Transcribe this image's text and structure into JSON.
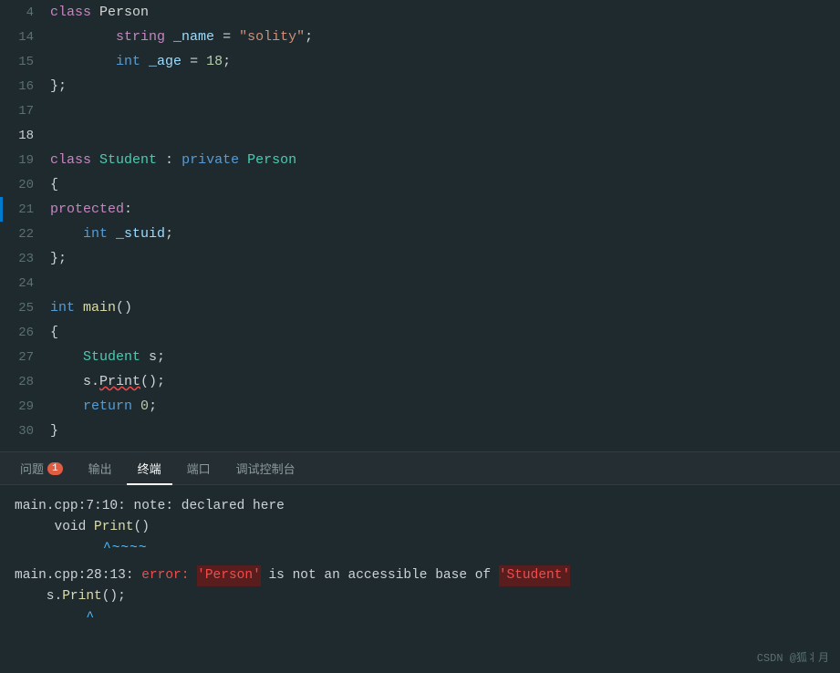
{
  "editor": {
    "lines": [
      {
        "num": "4",
        "tokens": [
          {
            "t": "kw-purple",
            "v": "class"
          },
          {
            "t": "kw-white",
            "v": " Person"
          }
        ]
      },
      {
        "num": "14",
        "tokens": [
          {
            "t": "kw-white",
            "v": "        "
          },
          {
            "t": "kw-purple",
            "v": "string"
          },
          {
            "t": "kw-cyan",
            "v": " _name"
          },
          {
            "t": "kw-white",
            "v": " = "
          },
          {
            "t": "kw-orange",
            "v": "\"solity\""
          },
          {
            "t": "kw-white",
            "v": ";"
          }
        ]
      },
      {
        "num": "15",
        "tokens": [
          {
            "t": "kw-white",
            "v": "        "
          },
          {
            "t": "kw-blue",
            "v": "int"
          },
          {
            "t": "kw-cyan",
            "v": " _age"
          },
          {
            "t": "kw-white",
            "v": " = "
          },
          {
            "t": "kw-number",
            "v": "18"
          },
          {
            "t": "kw-white",
            "v": ";"
          }
        ]
      },
      {
        "num": "16",
        "tokens": [
          {
            "t": "kw-white",
            "v": "};"
          }
        ]
      },
      {
        "num": "17",
        "tokens": []
      },
      {
        "num": "18",
        "tokens": []
      },
      {
        "num": "19",
        "tokens": [
          {
            "t": "kw-purple",
            "v": "class"
          },
          {
            "t": "kw-white",
            "v": " "
          },
          {
            "t": "kw-green",
            "v": "Student"
          },
          {
            "t": "kw-white",
            "v": " : "
          },
          {
            "t": "kw-blue",
            "v": "private"
          },
          {
            "t": "kw-white",
            "v": " "
          },
          {
            "t": "kw-green",
            "v": "Person"
          }
        ]
      },
      {
        "num": "20",
        "tokens": [
          {
            "t": "kw-white",
            "v": "{"
          }
        ]
      },
      {
        "num": "21",
        "tokens": [
          {
            "t": "kw-purple",
            "v": "protected"
          },
          {
            "t": "kw-white",
            "v": ":"
          }
        ]
      },
      {
        "num": "22",
        "tokens": [
          {
            "t": "kw-white",
            "v": "    "
          },
          {
            "t": "kw-blue",
            "v": "int"
          },
          {
            "t": "kw-cyan",
            "v": " _stuid"
          },
          {
            "t": "kw-white",
            "v": ";"
          }
        ]
      },
      {
        "num": "23",
        "tokens": [
          {
            "t": "kw-white",
            "v": "};"
          }
        ]
      },
      {
        "num": "24",
        "tokens": []
      },
      {
        "num": "25",
        "tokens": [
          {
            "t": "kw-blue",
            "v": "int"
          },
          {
            "t": "kw-white",
            "v": " "
          },
          {
            "t": "kw-yellow",
            "v": "main"
          },
          {
            "t": "kw-white",
            "v": "()"
          }
        ]
      },
      {
        "num": "26",
        "tokens": [
          {
            "t": "kw-white",
            "v": "{"
          }
        ]
      },
      {
        "num": "27",
        "tokens": [
          {
            "t": "kw-white",
            "v": "    "
          },
          {
            "t": "kw-green",
            "v": "Student"
          },
          {
            "t": "kw-white",
            "v": " s;"
          }
        ]
      },
      {
        "num": "28",
        "tokens": [
          {
            "t": "kw-white",
            "v": "    s."
          },
          {
            "t": "kw-squiggle",
            "v": "Print"
          },
          {
            "t": "kw-white",
            "v": "();"
          }
        ]
      },
      {
        "num": "29",
        "tokens": [
          {
            "t": "kw-white",
            "v": "    "
          },
          {
            "t": "kw-blue",
            "v": "return"
          },
          {
            "t": "kw-white",
            "v": " "
          },
          {
            "t": "kw-number",
            "v": "0"
          },
          {
            "t": "kw-white",
            "v": ";"
          }
        ]
      },
      {
        "num": "30",
        "tokens": [
          {
            "t": "kw-white",
            "v": "}"
          }
        ]
      }
    ]
  },
  "panel": {
    "tabs": [
      {
        "label": "问题",
        "active": false,
        "badge": "1"
      },
      {
        "label": "输出",
        "active": false,
        "badge": ""
      },
      {
        "label": "终端",
        "active": true,
        "badge": ""
      },
      {
        "label": "端口",
        "active": false,
        "badge": ""
      },
      {
        "label": "调试控制台",
        "active": false,
        "badge": ""
      }
    ],
    "terminal": {
      "line1_path": "main.cpp:7:10:",
      "line1_note": " note:",
      "line1_rest": " declared here",
      "line2_indent": "     void ",
      "line2_fn": "Print",
      "line2_rest": "()",
      "line3_tilde": "          ^~~~~",
      "line4_path": "main.cpp:28:13:",
      "line4_error": " error:",
      "line4_pre": " ",
      "line4_highlight1": "'Person'",
      "line4_mid": " is not an accessible base of ",
      "line4_highlight2": "'Student'",
      "line5_indent": "    s.",
      "line5_fn": "Print",
      "line5_rest": "();",
      "line6_caret": "         ^"
    }
  },
  "watermark": "CSDN @狐丬月"
}
